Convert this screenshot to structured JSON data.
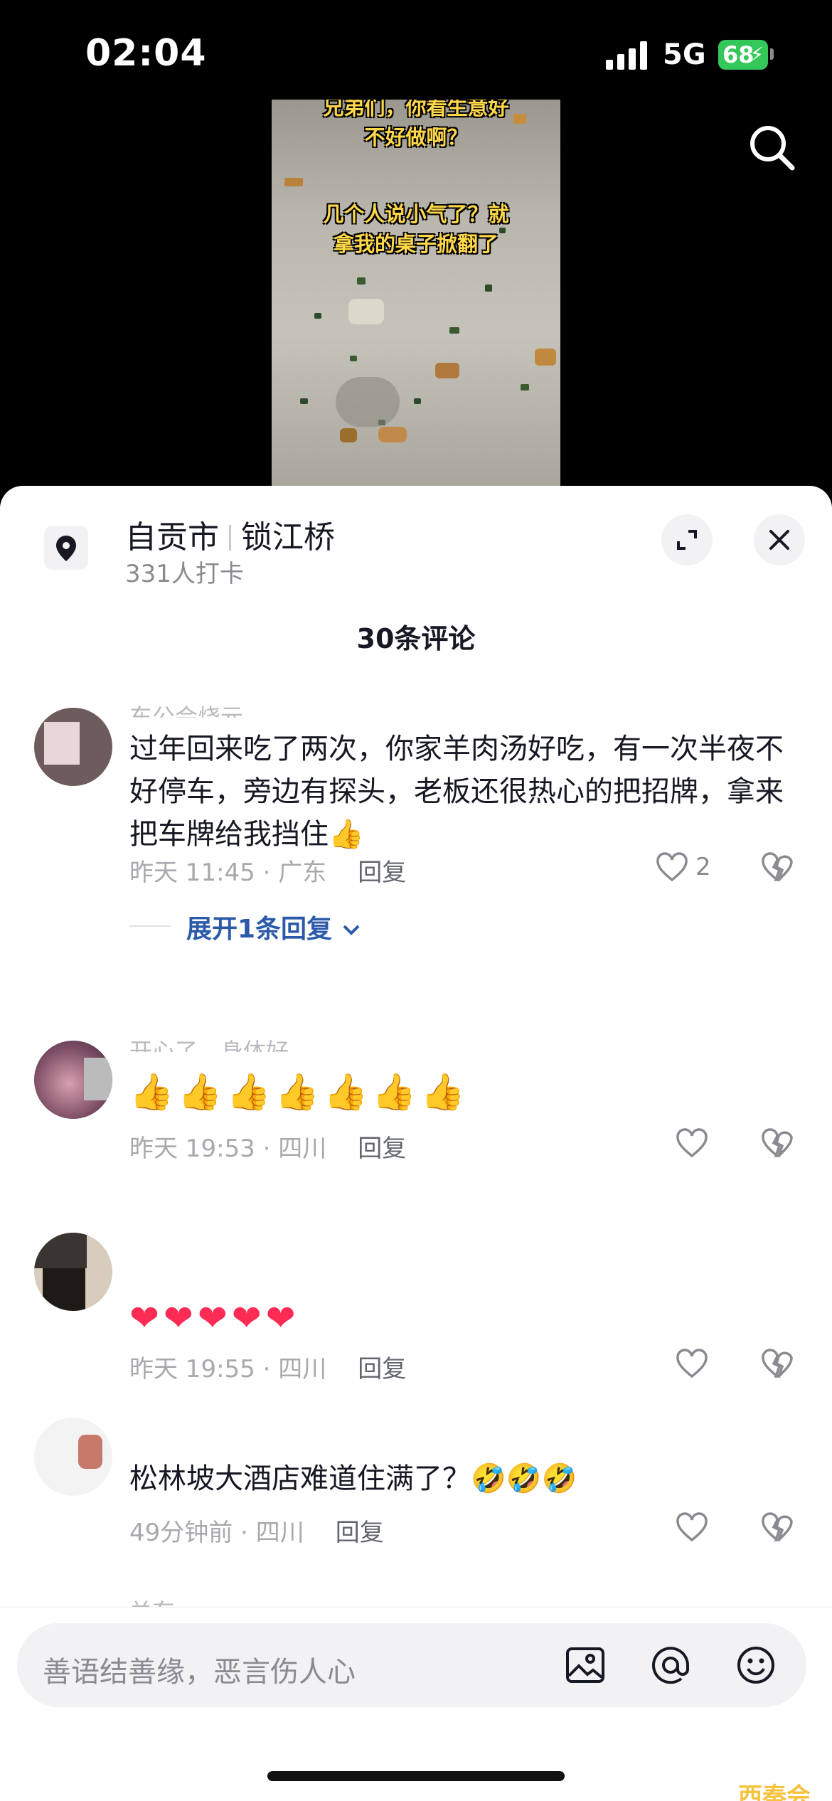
{
  "status_bar": {
    "time": "02:04",
    "network": "5G",
    "battery": "68"
  },
  "video": {
    "caption_top_line1": "兄弟们，你看生意好",
    "caption_top_line2": "不好做啊？",
    "caption_mid_line1": "几个人说小气了？就",
    "caption_mid_line2": "拿我的桌子掀翻了"
  },
  "location": {
    "city": "自贡市",
    "place": "锁江桥",
    "checkins": "331人打卡"
  },
  "comment_count": "30条评论",
  "comments": [
    {
      "nickname": "东公会烧元",
      "text": "过年回来吃了两次，你家羊肉汤好吃，有一次半夜不好停车，旁边有探头，老板还很热心的把招牌，拿来把车牌给我挡住👍",
      "time": "昨天 11:45",
      "region": "广东",
      "reply": "回复",
      "likes": "2",
      "expand": "展开1条回复"
    },
    {
      "nickname": "开心了，身体好",
      "emojis": [
        "👍",
        "👍",
        "👍",
        "👍",
        "👍",
        "👍",
        "👍"
      ],
      "time": "昨天 19:53",
      "region": "四川",
      "reply": "回复"
    },
    {
      "emojis": [
        "❤",
        "❤",
        "❤",
        "❤",
        "❤"
      ],
      "time": "昨天 19:55",
      "region": "四川",
      "reply": "回复"
    },
    {
      "text": "松林坡大酒店难道住满了？🤣🤣🤣",
      "time": "49分钟前",
      "region": "四川",
      "reply": "回复"
    }
  ],
  "next_nickname": "关东",
  "input": {
    "placeholder": "善语结善缘，恶言伤人心"
  },
  "watermark": "西秦会馆",
  "colors": {
    "accent": "#fe2c55",
    "expand_link": "#2b5aa8",
    "battery": "#34c759"
  }
}
